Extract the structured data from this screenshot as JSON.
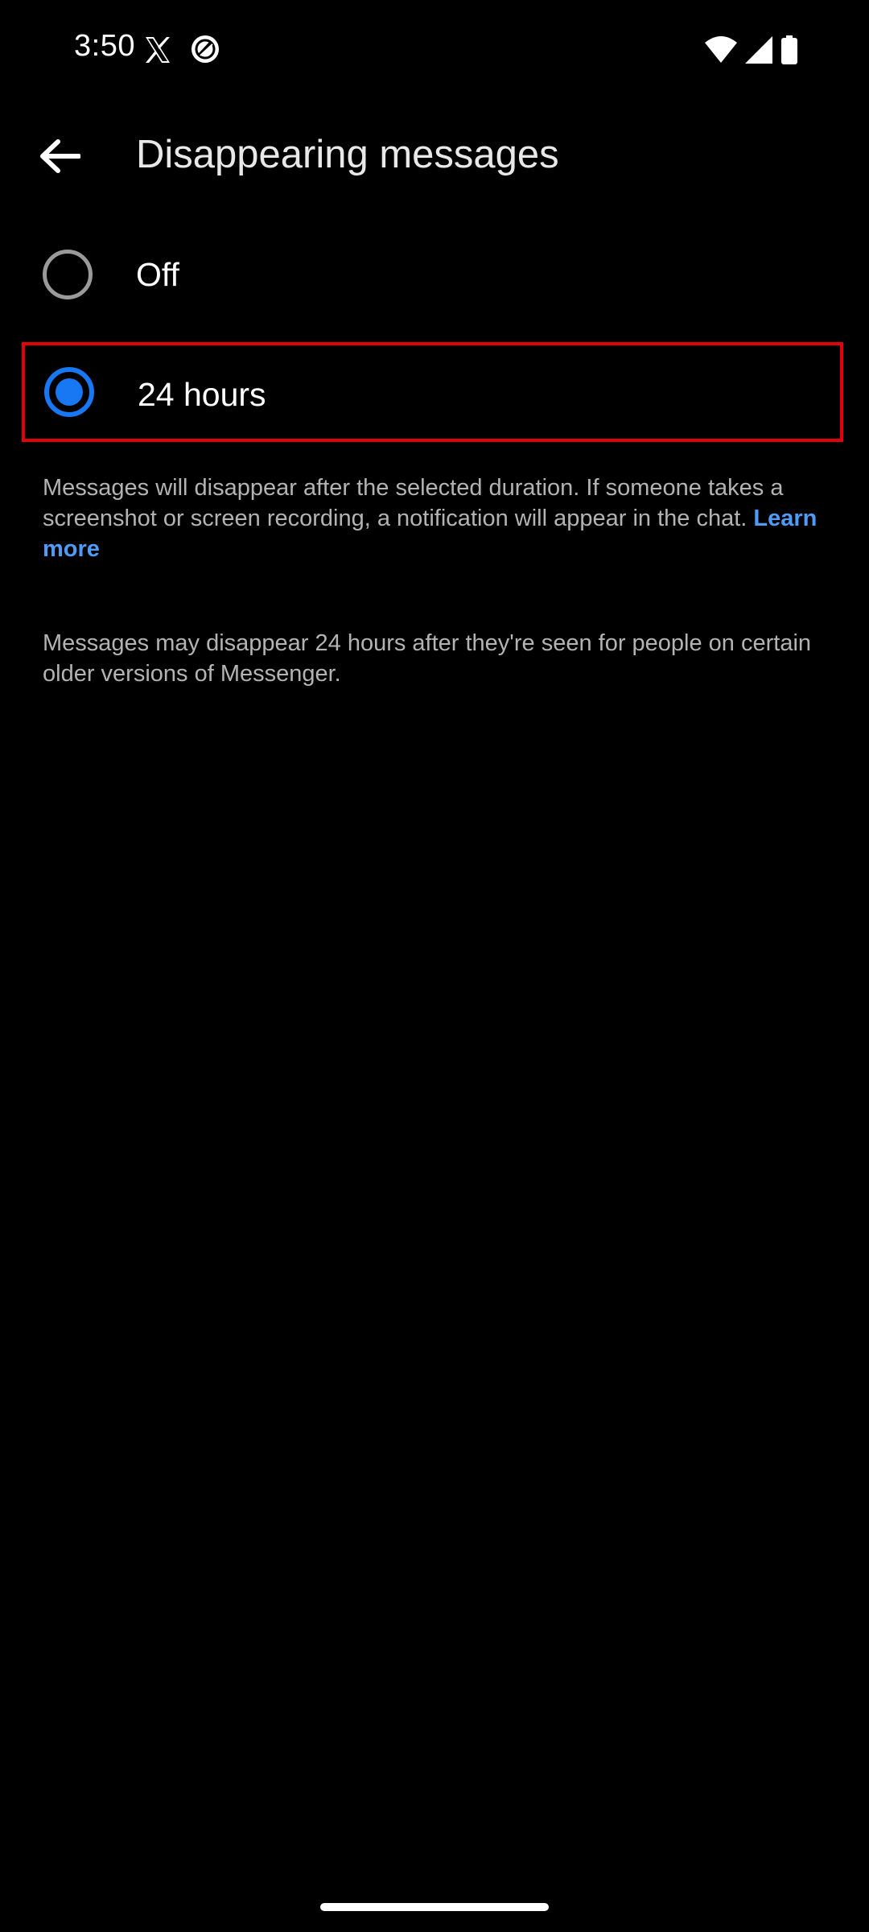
{
  "status_bar": {
    "time": "3:50",
    "icons": [
      "x-logo-icon",
      "compass-icon",
      "wifi-icon",
      "signal-icon",
      "battery-icon"
    ]
  },
  "app_bar": {
    "back_icon": "arrow-back-icon",
    "title": "Disappearing messages"
  },
  "options": [
    {
      "label": "Off",
      "selected": false
    },
    {
      "label": "24 hours",
      "selected": true
    }
  ],
  "description": {
    "text": "Messages will disappear after the selected duration. If someone takes a screenshot or screen recording, a notification will appear in the chat.",
    "link": "Learn more",
    "note": "Messages may disappear 24 hours after they're seen for people on certain older versions of Messenger."
  },
  "colors": {
    "accent": "#1877f2",
    "link": "#4e9cf5",
    "highlight_border": "#e3000b",
    "background": "#000000"
  }
}
